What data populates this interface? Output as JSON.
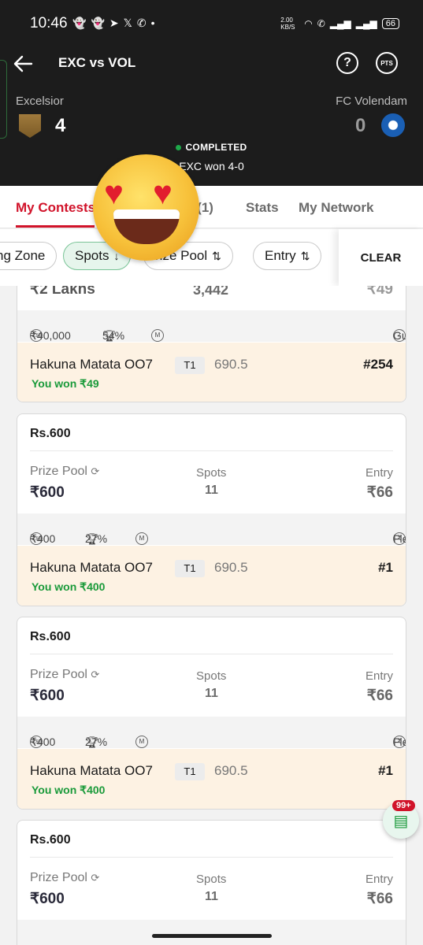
{
  "status_bar": {
    "time": "10:46",
    "notif_icons": [
      "snapchat-icon",
      "snapchat-icon",
      "telegram-icon",
      "x-icon",
      "whatsapp-icon",
      "dot-icon"
    ],
    "speed": "2.00 KB/S",
    "battery": "66"
  },
  "header": {
    "title": "EXC vs VOL",
    "help": "?",
    "pts": "PTS",
    "team_left": "Excelsior",
    "score_left": "4",
    "team_right": "FC Volendam",
    "score_right": "0",
    "status": "COMPLETED",
    "result": "EXC won 4-0"
  },
  "tabs": [
    {
      "label": "My Contests"
    },
    {
      "label": "s (1)"
    },
    {
      "label": "Stats"
    },
    {
      "label": "My Network"
    }
  ],
  "filters": {
    "chips": [
      "ng Zone",
      "Spots",
      "rize Pool",
      "Entry"
    ],
    "clear": "CLEAR"
  },
  "partial_card": {
    "prize": "₹2 Lakhs",
    "spots": "3,442",
    "entry": "₹49",
    "first": "₹40,000",
    "winners": "54%",
    "type": "Guaranteed",
    "team": "Hakuna Matata OO7",
    "team_tag": "T1",
    "points": "690.5",
    "rank": "#254",
    "won": "You won ₹49"
  },
  "cards": [
    {
      "title": "Rs.600",
      "prize_label": "Prize Pool",
      "prize": "₹600",
      "spots_label": "Spots",
      "spots": "11",
      "entry_label": "Entry",
      "entry": "₹66",
      "first": "₹400",
      "winners": "27%",
      "type": "Flexible",
      "team": "Hakuna Matata OO7",
      "team_tag": "T1",
      "points": "690.5",
      "rank": "#1",
      "won": "You won ₹400"
    },
    {
      "title": "Rs.600",
      "prize_label": "Prize Pool",
      "prize": "₹600",
      "spots_label": "Spots",
      "spots": "11",
      "entry_label": "Entry",
      "entry": "₹66",
      "first": "₹400",
      "winners": "27%",
      "type": "Flexible",
      "team": "Hakuna Matata OO7",
      "team_tag": "T1",
      "points": "690.5",
      "rank": "#1",
      "won": "You won ₹400"
    },
    {
      "title": "Rs.600",
      "prize_label": "Prize Pool",
      "prize": "₹600",
      "spots_label": "Spots",
      "spots": "11",
      "entry_label": "Entry",
      "entry": "₹66"
    }
  ],
  "chat": {
    "badge": "99+"
  }
}
